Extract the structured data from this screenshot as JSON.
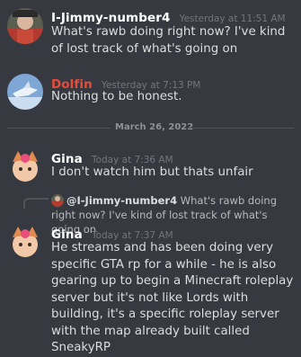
{
  "messages": [
    {
      "author": "I-Jimmy-number4",
      "author_color": "#ffffff",
      "timestamp": "Yesterday at 11:51 AM",
      "text": "What's rawb doing right now? I've kind of lost track of what's going on"
    },
    {
      "author": "Dolfin",
      "author_color": "#e74c3c",
      "timestamp": "Yesterday at 7:13 PM",
      "text": "Nothing to be honest."
    },
    {
      "author": "Gina",
      "author_color": "#ffffff",
      "timestamp": "Today at 7:36 AM",
      "text": "I don't watch him but thats unfair"
    },
    {
      "author": "Gina",
      "author_color": "#ffffff",
      "timestamp": "Today at 7:37 AM",
      "text": "He streams and has been doing very specific GTA rp for a while - he is also gearing up to begin a Minecraft roleplay server but it's not like Lords with building, it's a specific roleplay server with the map already built called SneakyRP"
    }
  ],
  "date_divider": "March 26, 2022",
  "reply": {
    "author": "@I-Jimmy-number4",
    "text": "What's rawb doing right now? I've kind of lost track of what's going on"
  }
}
